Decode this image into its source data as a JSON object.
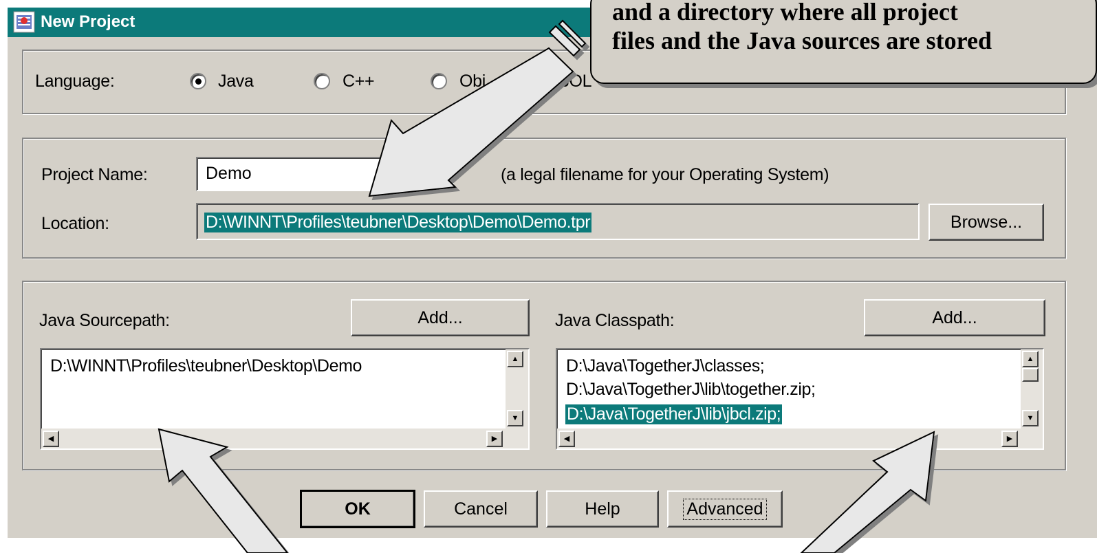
{
  "window": {
    "title": "New Project"
  },
  "callout": {
    "line1": "and a directory where all project",
    "line2": "files and the Java sources are stored"
  },
  "language": {
    "label": "Language:",
    "options": [
      {
        "label": "Java",
        "selected": true
      },
      {
        "label": "C++",
        "selected": false
      },
      {
        "label": "Obj",
        "selected": false
      },
      {
        "label": "OBOL",
        "selected": false
      }
    ]
  },
  "project": {
    "name_label": "Project Name:",
    "name_value": "Demo",
    "name_hint": "(a legal filename for your Operating System)",
    "location_label": "Location:",
    "location_value": "D:\\WINNT\\Profiles\\teubner\\Desktop\\Demo\\Demo.tpr",
    "browse_label": "Browse..."
  },
  "sourcepath": {
    "label": "Java Sourcepath:",
    "add_label": "Add...",
    "items": [
      "D:\\WINNT\\Profiles\\teubner\\Desktop\\Demo"
    ]
  },
  "classpath": {
    "label": "Java Classpath:",
    "add_label": "Add...",
    "items": [
      "D:\\Java\\TogetherJ\\classes;",
      "D:\\Java\\TogetherJ\\lib\\together.zip;",
      "D:\\Java\\TogetherJ\\lib\\jbcl.zip;"
    ],
    "selected_index": 2
  },
  "buttons": {
    "ok": "OK",
    "cancel": "Cancel",
    "help": "Help",
    "advanced": "Advanced"
  },
  "colors": {
    "title_bar": "#0c7a7a",
    "dialog_bg": "#d4d0c8",
    "selection": "#0c7a7a"
  }
}
